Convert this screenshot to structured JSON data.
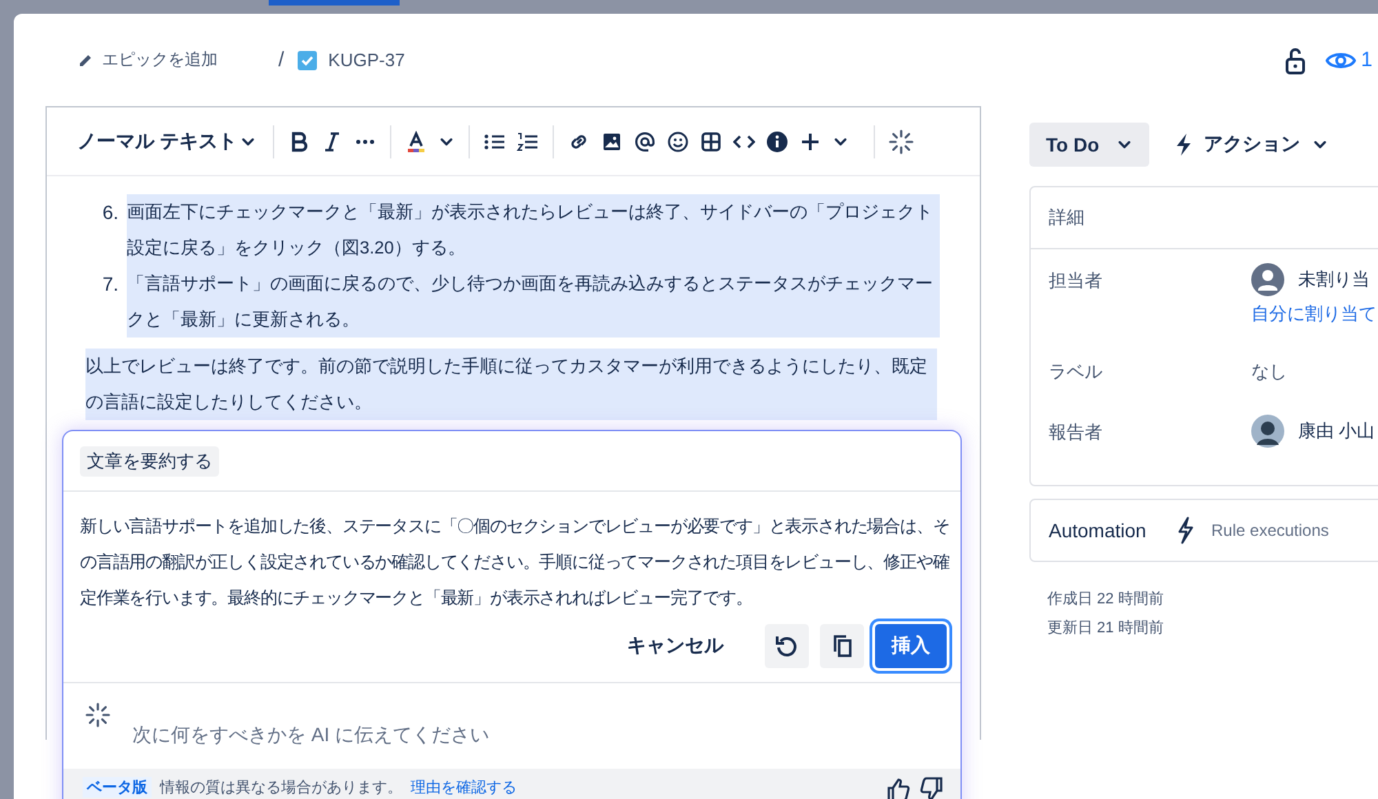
{
  "breadcrumb": {
    "epic": "エピックを追加",
    "separator": "/",
    "issue_key": "KUGP-37",
    "issue_checked": true
  },
  "watchers": {
    "count": "1"
  },
  "toolbar": {
    "text_style": "ノーマル テキスト"
  },
  "editor": {
    "list_items": [
      {
        "number": "6.",
        "text": "画面左下にチェックマークと「最新」が表示されたらレビューは終了、サイドバーの「プロジェクト設定に戻る」をクリック（図3.20）する。",
        "selected": true
      },
      {
        "number": "7.",
        "text": "「言語サポート」の画面に戻るので、少し待つか画面を再読み込みするとステータスがチェックマークと「最新」に更新される。",
        "selected": true
      }
    ],
    "paragraph": {
      "text": "以上でレビューは終了です。前の節で説明した手順に従ってカスタマーが利用できるようにしたり、既定の言語に設定したりしてください。",
      "selected": true
    }
  },
  "ai_panel": {
    "command": "文章を要約する",
    "summary": "新しい言語サポートを追加した後、ステータスに「〇個のセクションでレビューが必要です」と表示された場合は、その言語用の翻訳が正しく設定されているか確認してください。手順に従ってマークされた項目をレビューし、修正や確定作業を行います。最終的にチェックマークと「最新」が表示されればレビュー完了です。",
    "actions": [
      {
        "kind": "text",
        "label": "キャンセル"
      },
      {
        "kind": "retry"
      },
      {
        "kind": "copy"
      },
      {
        "kind": "primary",
        "label": "挿入"
      }
    ],
    "prompt": {
      "placeholder": "次に何をすべきかを AI に伝えてください"
    },
    "footer": {
      "badge": "ベータ版",
      "note": "情報の質は異なる場合があります。",
      "link": "理由を確認する"
    }
  },
  "status_button": "To Do",
  "action_button": "アクション",
  "details": {
    "title": "詳細",
    "fields": [
      {
        "kind": "unassigned",
        "label": "担当者",
        "value": "未割り当",
        "link": "自分に割り当て"
      },
      {
        "kind": "text",
        "label": "ラベル",
        "value": "なし"
      },
      {
        "kind": "user",
        "label": "報告者",
        "value": "康由 小山"
      }
    ]
  },
  "automation": {
    "title": "Automation",
    "link": "Rule executions"
  },
  "dates": [
    "作成日 22 時間前",
    "更新日 21 時間前"
  ]
}
